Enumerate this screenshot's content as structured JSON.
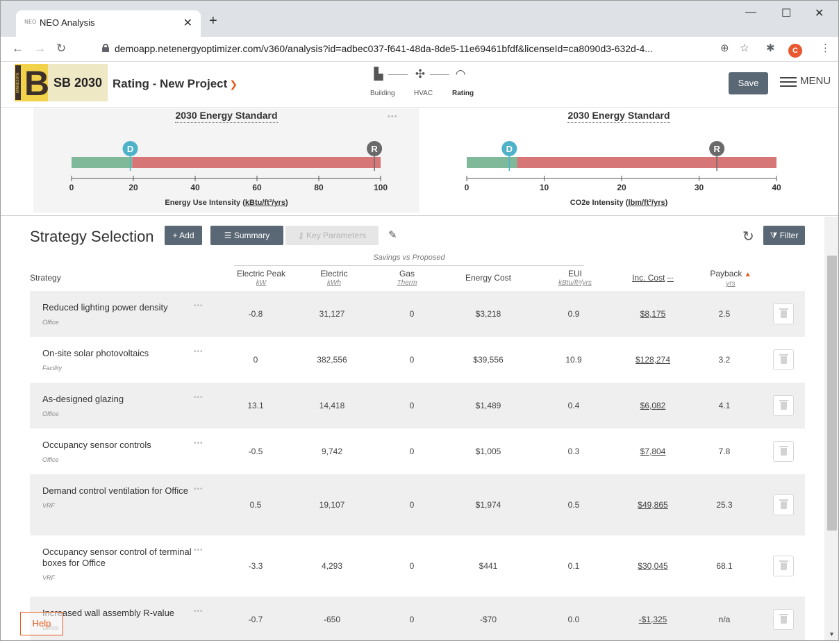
{
  "browser": {
    "tab_title": "NEO Analysis",
    "tab_favicon": "NEO",
    "url": "demoapp.netenergyoptimizer.com/v360/analysis?id=adbec037-f641-48da-8de5-11e69461bfdf&licenseId=ca8090d3-632d-4...",
    "profile_initial": "C",
    "icons": [
      "back-icon",
      "forward-icon",
      "reload-icon",
      "lock-icon",
      "zoom-icon",
      "star-icon",
      "extensions-icon",
      "kebab-menu-icon"
    ]
  },
  "header": {
    "logo_side_text": "MINNESOTA",
    "logo_big_text": "B3",
    "program_name": "SB 2030",
    "project_title": "Rating - New Project",
    "steps": [
      {
        "label": "Building",
        "icon": "building-icon"
      },
      {
        "label": "HVAC",
        "icon": "fan-icon"
      },
      {
        "label": "Rating",
        "icon": "gauge-icon"
      }
    ],
    "save_label": "Save",
    "menu_label": "MENU"
  },
  "gauges": [
    {
      "title": "2030 Energy Standard",
      "unit_prefix": "Energy Use Intensity (",
      "unit_link": "kBtu/ft²/yrs",
      "unit_suffix": ")",
      "axis": {
        "min": 0,
        "max": 100,
        "ticks": [
          0,
          20,
          40,
          60,
          80,
          100
        ]
      },
      "design_value": 19,
      "reference_value": 98,
      "target_value": 19.6,
      "design_label": "D",
      "reference_label": "R",
      "colors": {
        "good": "#7fb99a",
        "bad": "#d77677",
        "design": "#4fb2c8",
        "reference": "#6a6a6a"
      }
    },
    {
      "title": "2030 Energy Standard",
      "unit_prefix": "CO2e Intensity (",
      "unit_link": "lbm/ft²/yrs",
      "unit_suffix": ")",
      "axis": {
        "min": 0,
        "max": 40,
        "ticks": [
          0,
          10,
          20,
          30,
          40
        ]
      },
      "design_value": 5.5,
      "reference_value": 32.3,
      "target_value": 6.5,
      "design_label": "D",
      "reference_label": "R",
      "colors": {
        "good": "#7fb99a",
        "bad": "#d77677",
        "design": "#4fb2c8",
        "reference": "#6a6a6a"
      }
    }
  ],
  "strategy": {
    "title": "Strategy Selection",
    "add_label": "+ Add",
    "summary_label": "Summary",
    "key_params_label": "Key Parameters",
    "filter_label": "Filter",
    "savings_group_label": "Savings vs Proposed",
    "columns": {
      "strategy": "Strategy",
      "peak": {
        "label": "Electric Peak",
        "unit": "kW"
      },
      "electric": {
        "label": "Electric",
        "unit": "kWh"
      },
      "gas": {
        "label": "Gas",
        "unit": "Therm"
      },
      "cost": {
        "label": "Energy Cost"
      },
      "eui": {
        "label": "EUI",
        "unit": "kBtu/ft²/yrs"
      },
      "inc_cost": {
        "label": "Inc. Cost"
      },
      "payback": {
        "label": "Payback",
        "unit": "yrs"
      }
    },
    "rows": [
      {
        "name": "Reduced lighting power density",
        "category": "Office",
        "peak": "-0.8",
        "electric": "31,127",
        "gas": "0",
        "cost": "$3,218",
        "eui": "0.9",
        "inc_cost": "$8,175",
        "payback": "2.5"
      },
      {
        "name": "On-site solar photovoltaics",
        "category": "Facility",
        "peak": "0",
        "electric": "382,556",
        "gas": "0",
        "cost": "$39,556",
        "eui": "10.9",
        "inc_cost": "$128,274",
        "payback": "3.2"
      },
      {
        "name": "As-designed glazing",
        "category": "Office",
        "peak": "13.1",
        "electric": "14,418",
        "gas": "0",
        "cost": "$1,489",
        "eui": "0.4",
        "inc_cost": "$6,082",
        "payback": "4.1"
      },
      {
        "name": "Occupancy sensor controls",
        "category": "Office",
        "peak": "-0.5",
        "electric": "9,742",
        "gas": "0",
        "cost": "$1,005",
        "eui": "0.3",
        "inc_cost": "$7,804",
        "payback": "7.8"
      },
      {
        "name": "Demand control ventilation for Office",
        "category": "VRF",
        "peak": "0.5",
        "electric": "19,107",
        "gas": "0",
        "cost": "$1,974",
        "eui": "0.5",
        "inc_cost": "$49,865",
        "payback": "25.3"
      },
      {
        "name": "Occupancy sensor control of terminal boxes for Office",
        "category": "VRF",
        "peak": "-3.3",
        "electric": "4,293",
        "gas": "0",
        "cost": "$441",
        "eui": "0.1",
        "inc_cost": "$30,045",
        "payback": "68.1"
      },
      {
        "name": "Increased wall assembly R-value",
        "category": "Office",
        "peak": "-0.7",
        "electric": "-650",
        "gas": "0",
        "cost": "-$70",
        "eui": "0.0",
        "inc_cost": "-$1,325",
        "payback": "n/a"
      }
    ]
  },
  "help_label": "Help"
}
